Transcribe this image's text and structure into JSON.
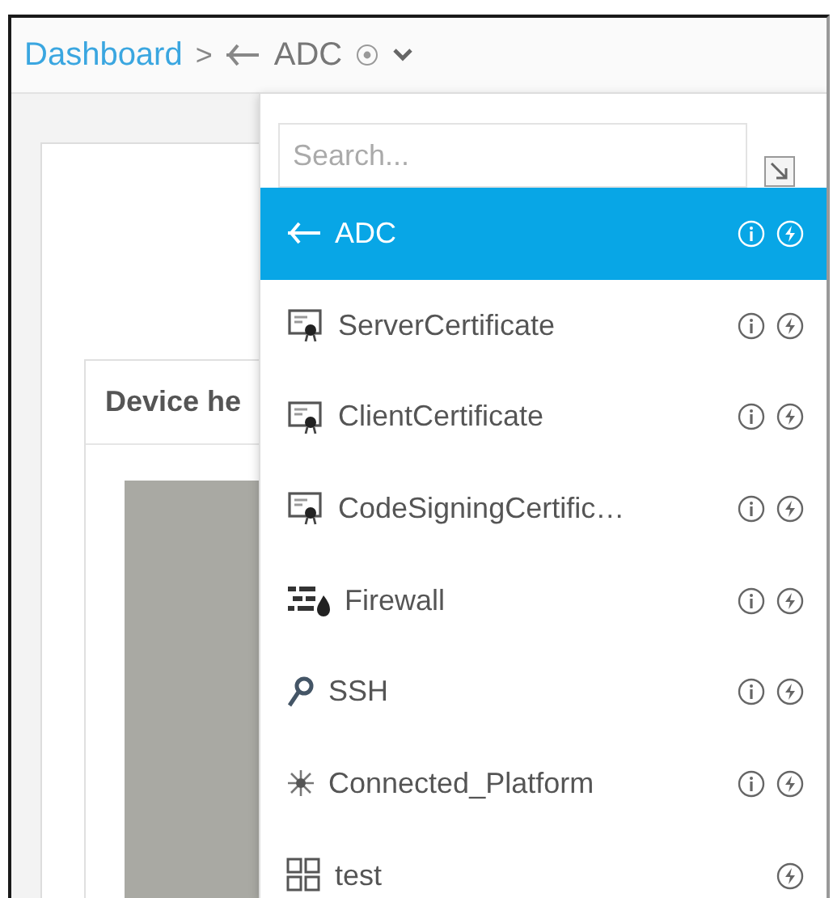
{
  "breadcrumb": {
    "root": "Dashboard",
    "separator": ">",
    "current": "ADC"
  },
  "background_card": {
    "title": "Device he"
  },
  "dropdown": {
    "search": {
      "placeholder": "Search..."
    },
    "items": [
      {
        "label": "ADC",
        "kind": "plane",
        "selected": true,
        "info": true
      },
      {
        "label": "ServerCertificate",
        "kind": "certificate",
        "selected": false,
        "info": true
      },
      {
        "label": "ClientCertificate",
        "kind": "certificate",
        "selected": false,
        "info": true
      },
      {
        "label": "CodeSigningCertific…",
        "kind": "certificate",
        "selected": false,
        "info": true
      },
      {
        "label": "Firewall",
        "kind": "firewall",
        "selected": false,
        "info": true
      },
      {
        "label": "SSH",
        "kind": "key",
        "selected": false,
        "info": true
      },
      {
        "label": "Connected_Platform",
        "kind": "spark",
        "selected": false,
        "info": true
      },
      {
        "label": "test",
        "kind": "grid",
        "selected": false,
        "info": false
      }
    ]
  }
}
